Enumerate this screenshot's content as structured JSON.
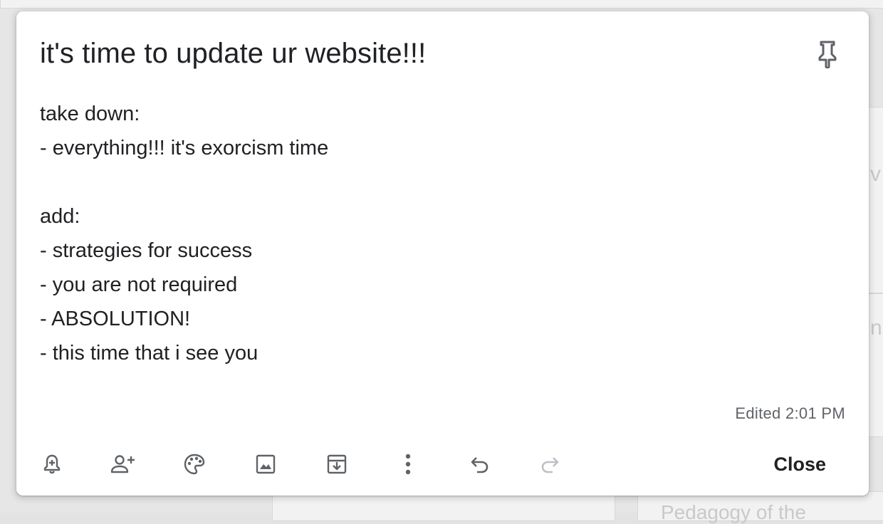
{
  "note": {
    "title": "it's time to update ur website!!!",
    "body_lines": [
      "take down:",
      "- everything!!! it's exorcism time",
      "",
      "add:",
      "- strategies for success",
      "- you are not required",
      "- ABSOLUTION!",
      "- this time that i see you"
    ],
    "edited": "Edited 2:01 PM",
    "pinned": false
  },
  "toolbar": {
    "icons": [
      "remind-me-icon",
      "collaborator-icon",
      "background-options-icon",
      "add-image-icon",
      "archive-icon",
      "more-icon",
      "undo-icon",
      "redo-icon"
    ],
    "close_label": "Close",
    "redo_enabled": false
  },
  "background": {
    "partial_texts": [
      "v",
      "n",
      "Pedagogy of the"
    ]
  },
  "colors": {
    "text": "#202124",
    "icon": "#5f6368",
    "disabled_icon": "#bdc1c6",
    "card": "#ffffff"
  }
}
